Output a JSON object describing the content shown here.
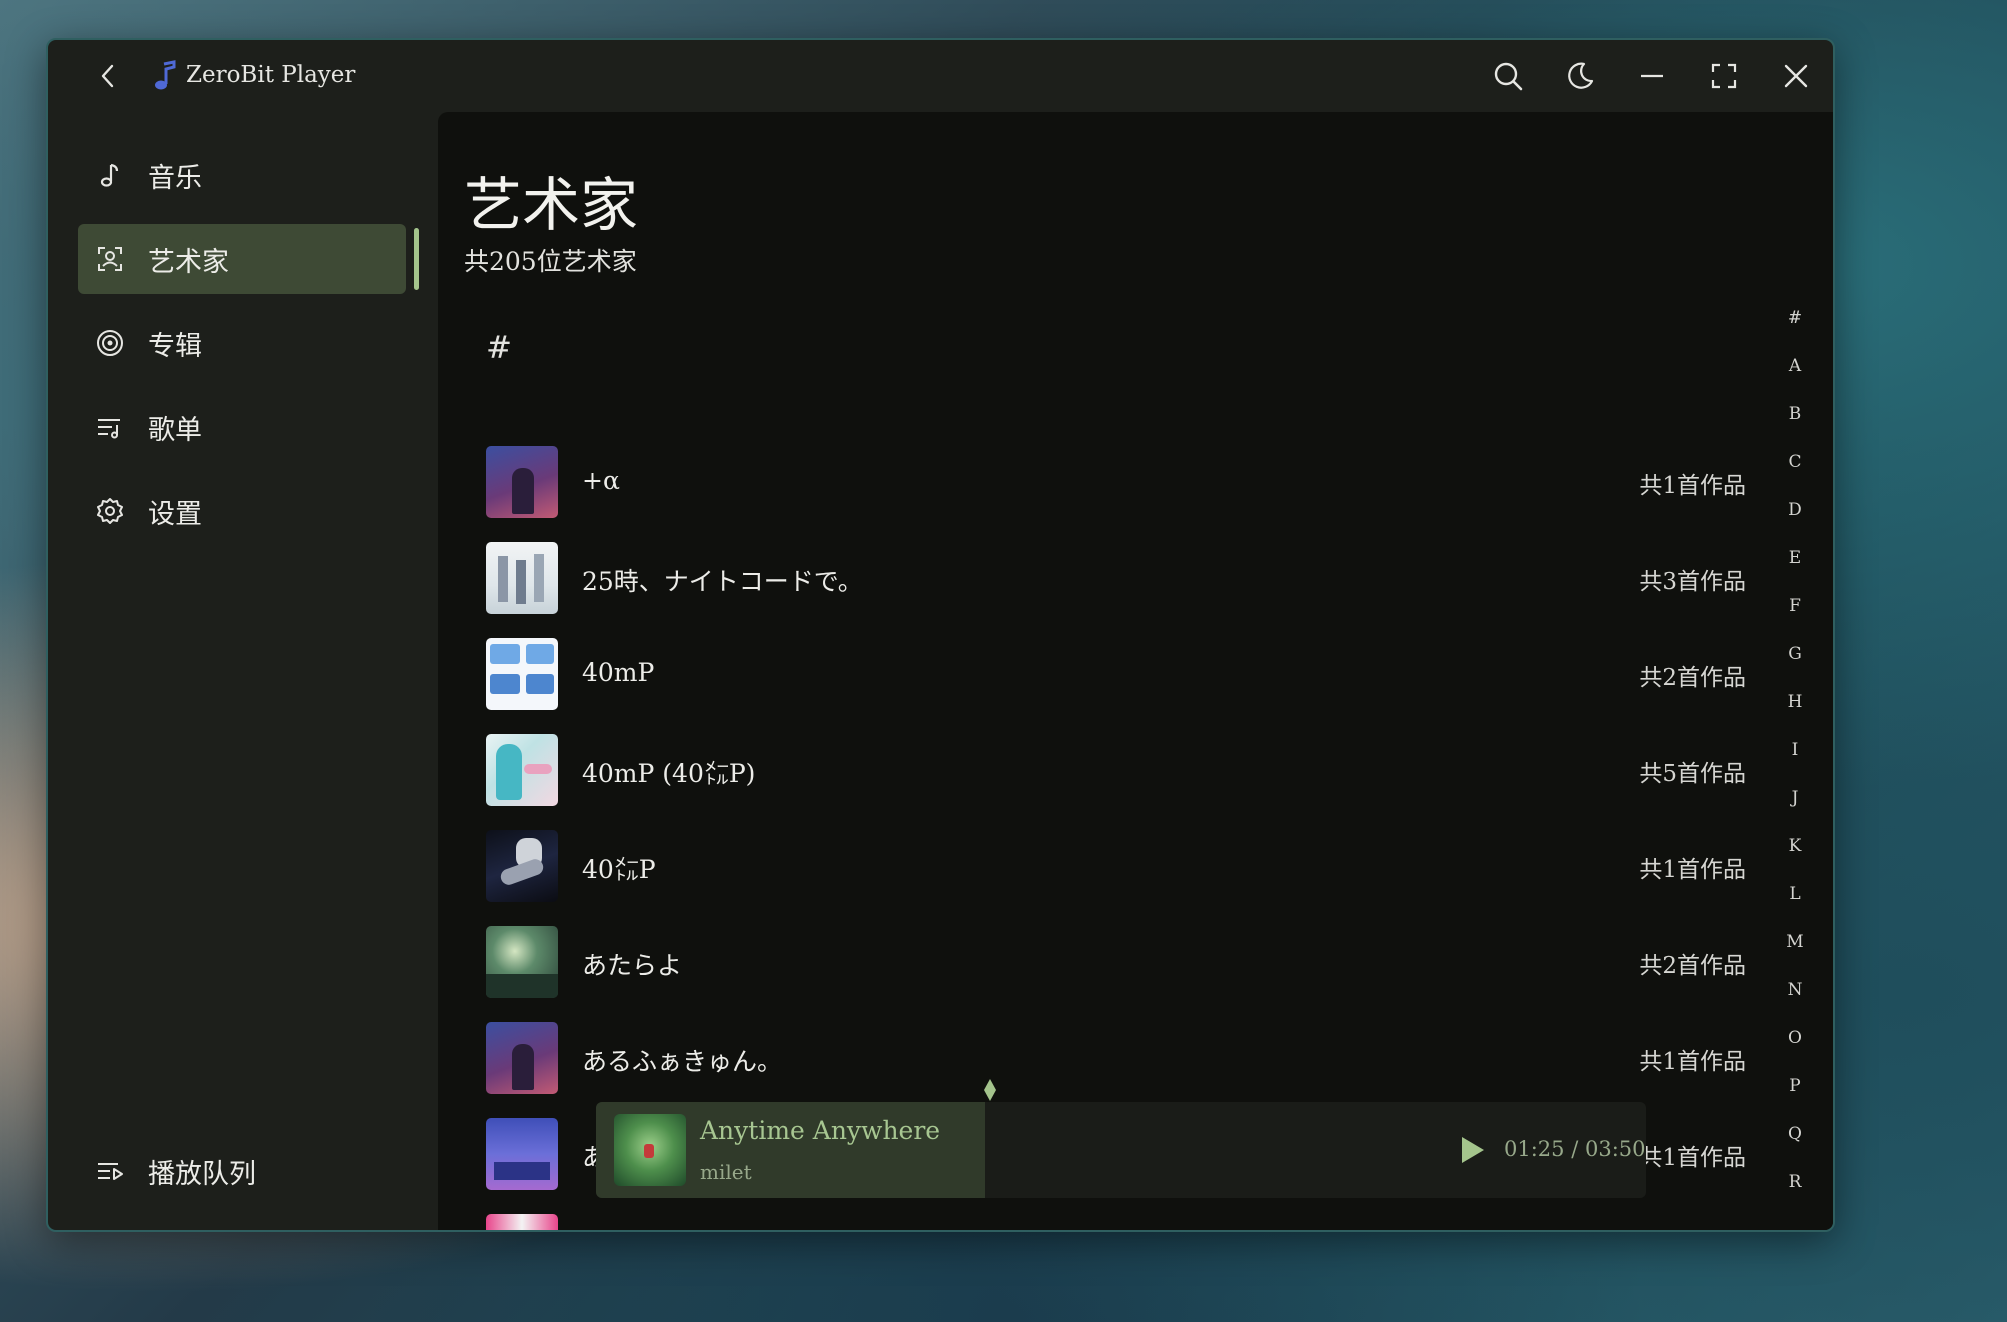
{
  "window": {
    "app_title": "ZeroBit Player",
    "accent": "#a4c48c"
  },
  "sidebar": {
    "items": [
      {
        "label": "音乐",
        "icon": "music-note-icon"
      },
      {
        "label": "艺术家",
        "icon": "artist-icon",
        "active": true
      },
      {
        "label": "专辑",
        "icon": "album-icon"
      },
      {
        "label": "歌单",
        "icon": "playlist-icon"
      },
      {
        "label": "设置",
        "icon": "settings-icon"
      }
    ],
    "queue_label": "播放队列"
  },
  "main": {
    "title": "艺术家",
    "subtitle": "共205位艺术家",
    "group_header": "#",
    "artists": [
      {
        "name": "+α",
        "count": "共1首作品"
      },
      {
        "name": "25時、ナイトコードで。",
        "count": "共3首作品"
      },
      {
        "name": "40mP",
        "count": "共2首作品"
      },
      {
        "name": "40mP (40㍍P)",
        "count": "共5首作品"
      },
      {
        "name": "40㍍P",
        "count": "共1首作品"
      },
      {
        "name": "あたらよ",
        "count": "共2首作品"
      },
      {
        "name": "あるふぁきゅん。",
        "count": "共1首作品"
      },
      {
        "name": "あ",
        "count": "共1首作品"
      }
    ],
    "alphabet": [
      "#",
      "A",
      "B",
      "C",
      "D",
      "E",
      "F",
      "G",
      "H",
      "I",
      "J",
      "K",
      "L",
      "M",
      "N",
      "O",
      "P",
      "Q",
      "R"
    ]
  },
  "player": {
    "title": "Anytime Anywhere",
    "artist": "milet",
    "current_time": "01:25",
    "separator": "/",
    "total_time": "03:50",
    "progress": 0.37
  }
}
